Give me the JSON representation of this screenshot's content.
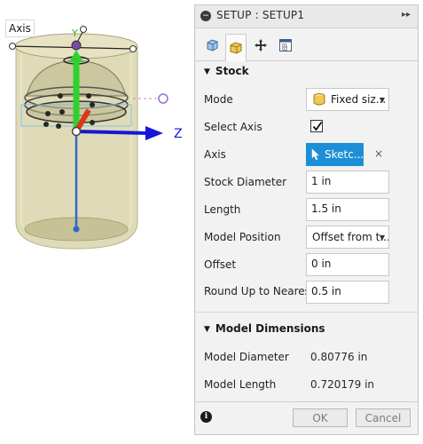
{
  "viewport": {
    "axis_tag": "Axis",
    "axis_labels": {
      "y": "Y",
      "z": "Z"
    }
  },
  "dialog": {
    "title": "SETUP : SETUP1",
    "expand_icon": "double-chevron-right-icon",
    "tabs": [
      {
        "icon": "setup-tab-icon",
        "active": false
      },
      {
        "icon": "stock-tab-icon",
        "active": true
      },
      {
        "icon": "post-process-tab-icon",
        "active": false
      },
      {
        "icon": "properties-tab-icon",
        "active": false
      }
    ],
    "stock_section": {
      "title": "Stock",
      "mode": {
        "label": "Mode",
        "value": "Fixed siz..."
      },
      "select_axis": {
        "label": "Select Axis",
        "checked": true
      },
      "axis": {
        "label": "Axis",
        "button": "Sketc...",
        "clear": "×"
      },
      "stock_diameter": {
        "label": "Stock Diameter",
        "value": "1 in"
      },
      "length": {
        "label": "Length",
        "value": "1.5 in"
      },
      "model_position": {
        "label": "Model Position",
        "value": "Offset from t..."
      },
      "offset": {
        "label": "Offset",
        "value": "0 in"
      },
      "round_up": {
        "label": "Round Up to Nearest",
        "value": "0.5 in"
      }
    },
    "model_dimensions": {
      "title": "Model Dimensions",
      "diameter": {
        "label": "Model Diameter",
        "value": "0.80776 in"
      },
      "length": {
        "label": "Model Length",
        "value": "0.720179 in"
      }
    },
    "footer": {
      "ok": "OK",
      "cancel": "Cancel"
    }
  },
  "colors": {
    "accent_blue": "#1d8fd6",
    "stock_body": "#d8d4a8",
    "y_axis": "#2fd12f",
    "z_axis": "#1616d8",
    "x_axis": "#d83818"
  }
}
